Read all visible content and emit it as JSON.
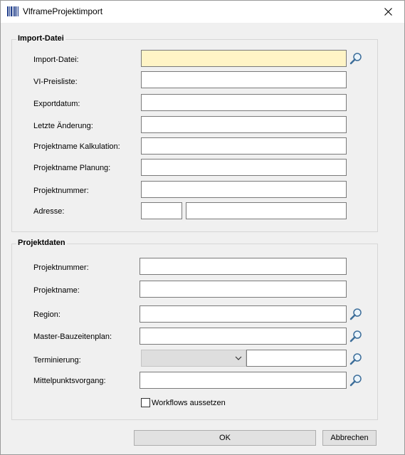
{
  "window": {
    "title": "VlframeProjektimport",
    "close_glyph": "✕"
  },
  "import_group": {
    "title": "Import-Datei",
    "labels": {
      "import_datei": "Import-Datei:",
      "vi_preisliste": "VI-Preisliste:",
      "exportdatum": "Exportdatum:",
      "letzte_aenderung": "Letzte Änderung:",
      "projektname_kalkulation": "Projektname Kalkulation:",
      "projektname_planung": "Projektname Planung:",
      "projektnummer": "Projektnummer:",
      "adresse": "Adresse:"
    },
    "values": {
      "import_datei": "",
      "vi_preisliste": "",
      "exportdatum": "",
      "letzte_aenderung": "",
      "projektname_kalkulation": "",
      "projektname_planung": "",
      "projektnummer": "",
      "adresse_plz": "",
      "adresse_ort": ""
    }
  },
  "projekt_group": {
    "title": "Projektdaten",
    "labels": {
      "projektnummer": "Projektnummer:",
      "projektname": "Projektname:",
      "region": "Region:",
      "master_bauzeitenplan": "Master-Bauzeitenplan:",
      "terminierung": "Terminierung:",
      "mittelpunktsvorgang": "Mittelpunktsvorgang:"
    },
    "values": {
      "projektnummer": "",
      "projektname": "",
      "region": "",
      "master_bauzeitenplan": "",
      "terminierung_select": "",
      "terminierung": "",
      "mittelpunktsvorgang": ""
    },
    "workflows_checkbox": {
      "label": "Workflows aussetzen",
      "checked": false
    }
  },
  "buttons": {
    "ok": "OK",
    "cancel": "Abbrechen"
  },
  "colors": {
    "highlight_field": "#fff4c6",
    "border": "#7a7a7a",
    "background": "#f0f0f0"
  },
  "icons": {
    "search": "magnifier-icon",
    "app": "barcode-icon",
    "close": "close-icon",
    "dropdown": "chevron-down-icon"
  }
}
